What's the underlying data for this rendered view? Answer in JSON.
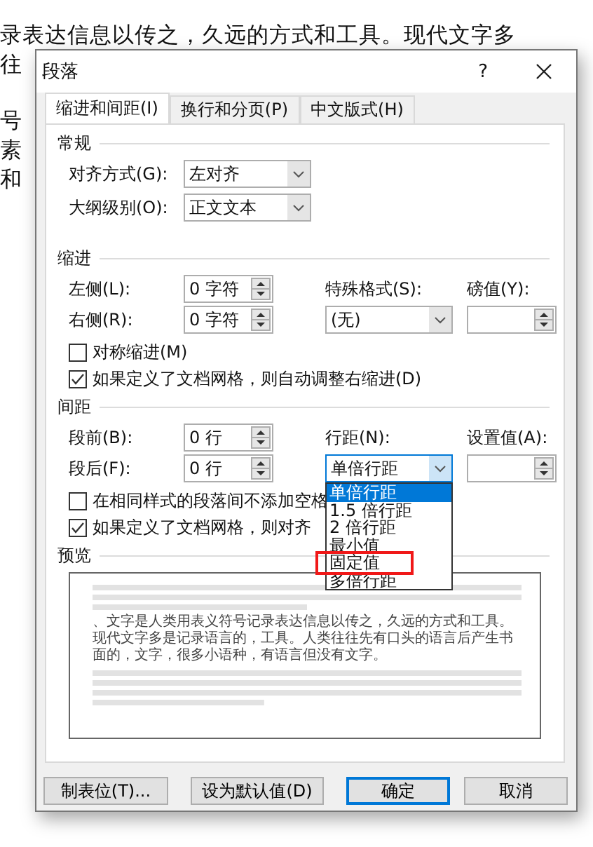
{
  "document": {
    "paragraphs": [
      [
        "录表达信息以传之，久远的方式和工具。现代文字多",
        "往"
      ],
      [
        "号",
        "素",
        "和"
      ]
    ]
  },
  "dialog": {
    "title": "段落",
    "help": "?",
    "tabs": [
      {
        "label": "缩进和间距(I)",
        "selected": true
      },
      {
        "label": "换行和分页(P)",
        "selected": false
      },
      {
        "label": "中文版式(H)",
        "selected": false
      }
    ],
    "general": {
      "heading": "常规",
      "fields": [
        {
          "label": "对齐方式(G):",
          "value": "左对齐"
        },
        {
          "label": "大纲级别(O):",
          "value": "正文文本"
        }
      ]
    },
    "indent": {
      "heading": "缩进",
      "left": {
        "label": "左侧(L):",
        "value": "0 字符"
      },
      "right": {
        "label": "右侧(R):",
        "value": "0 字符"
      },
      "special": {
        "label": "特殊格式(S):",
        "value": "(无)"
      },
      "by": {
        "label": "磅值(Y):"
      },
      "checkboxes": [
        {
          "label": "对称缩进(M)",
          "checked": false
        },
        {
          "label": "如果定义了文档网格，则自动调整右缩进(D)",
          "checked": true
        }
      ]
    },
    "spacing": {
      "heading": "间距",
      "before": {
        "label": "段前(B):",
        "value": "0 行"
      },
      "after": {
        "label": "段后(F):",
        "value": "0 行"
      },
      "line": {
        "label": "行距(N):",
        "value": "单倍行距",
        "open": true
      },
      "at": {
        "label": "设置值(A):"
      },
      "checkboxes": [
        {
          "label": "在相同样式的段落间不添加空格",
          "checked": false
        },
        {
          "label": "如果定义了文档网格，则对齐",
          "checked": true
        }
      ],
      "options": [
        {
          "label": "单倍行距",
          "selected": true,
          "highlighted": false
        },
        {
          "label": "1.5 倍行距",
          "selected": false,
          "highlighted": false
        },
        {
          "label": "2 倍行距",
          "selected": false,
          "highlighted": false
        },
        {
          "label": "最小值",
          "selected": false,
          "highlighted": false
        },
        {
          "label": "固定值",
          "selected": false,
          "highlighted": true
        },
        {
          "label": "多倍行距",
          "selected": false,
          "highlighted": false
        }
      ]
    },
    "preview": {
      "heading": "预览",
      "sample_text": "、文字是人类用表义符号记录表达信息以传之，久远的方式和工具。现代文字多是记录语言的，工具。人类往往先有口头的语言后产生书面的，文字，很多小语种，有语言但没有文字。"
    },
    "buttons": [
      {
        "label": "制表位(T)...",
        "default": false
      },
      {
        "label": "设为默认值(D)",
        "default": false
      },
      {
        "label": "确定",
        "default": true
      },
      {
        "label": "取消",
        "default": false
      }
    ]
  }
}
